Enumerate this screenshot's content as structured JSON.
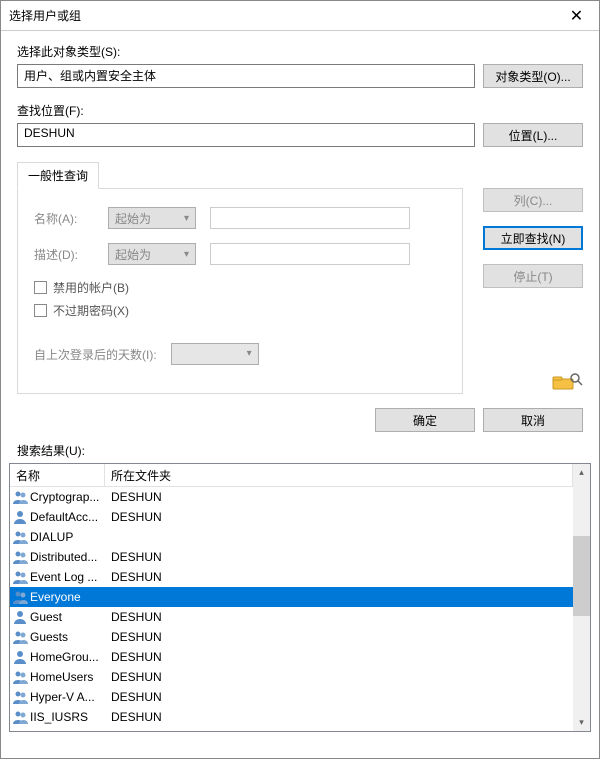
{
  "window": {
    "title": "选择用户或组"
  },
  "labels": {
    "objectType": "选择此对象类型(S):",
    "location": "查找位置(F):",
    "tab": "一般性查询",
    "name": "名称(A):",
    "description": "描述(D):",
    "disabledAccount": "禁用的帐户(B)",
    "pwdNoExpire": "不过期密码(X)",
    "daysSinceLogin": "自上次登录后的天数(I):",
    "results": "搜索结果(U):",
    "colName": "名称",
    "colFolder": "所在文件夹"
  },
  "fields": {
    "objectType": "用户、组或内置安全主体",
    "location": "DESHUN",
    "matchMode": "起始为"
  },
  "buttons": {
    "objectTypes": "对象类型(O)...",
    "locations": "位置(L)...",
    "columns": "列(C)...",
    "findNow": "立即查找(N)",
    "stop": "停止(T)",
    "ok": "确定",
    "cancel": "取消"
  },
  "results": [
    {
      "name": "Cryptograp...",
      "folder": "DESHUN",
      "icon": "group"
    },
    {
      "name": "DefaultAcc...",
      "folder": "DESHUN",
      "icon": "user"
    },
    {
      "name": "DIALUP",
      "folder": "",
      "icon": "group"
    },
    {
      "name": "Distributed...",
      "folder": "DESHUN",
      "icon": "group"
    },
    {
      "name": "Event Log ...",
      "folder": "DESHUN",
      "icon": "group"
    },
    {
      "name": "Everyone",
      "folder": "",
      "icon": "group",
      "selected": true
    },
    {
      "name": "Guest",
      "folder": "DESHUN",
      "icon": "user"
    },
    {
      "name": "Guests",
      "folder": "DESHUN",
      "icon": "group"
    },
    {
      "name": "HomeGrou...",
      "folder": "DESHUN",
      "icon": "user"
    },
    {
      "name": "HomeUsers",
      "folder": "DESHUN",
      "icon": "group"
    },
    {
      "name": "Hyper-V A...",
      "folder": "DESHUN",
      "icon": "group"
    },
    {
      "name": "IIS_IUSRS",
      "folder": "DESHUN",
      "icon": "group"
    }
  ]
}
